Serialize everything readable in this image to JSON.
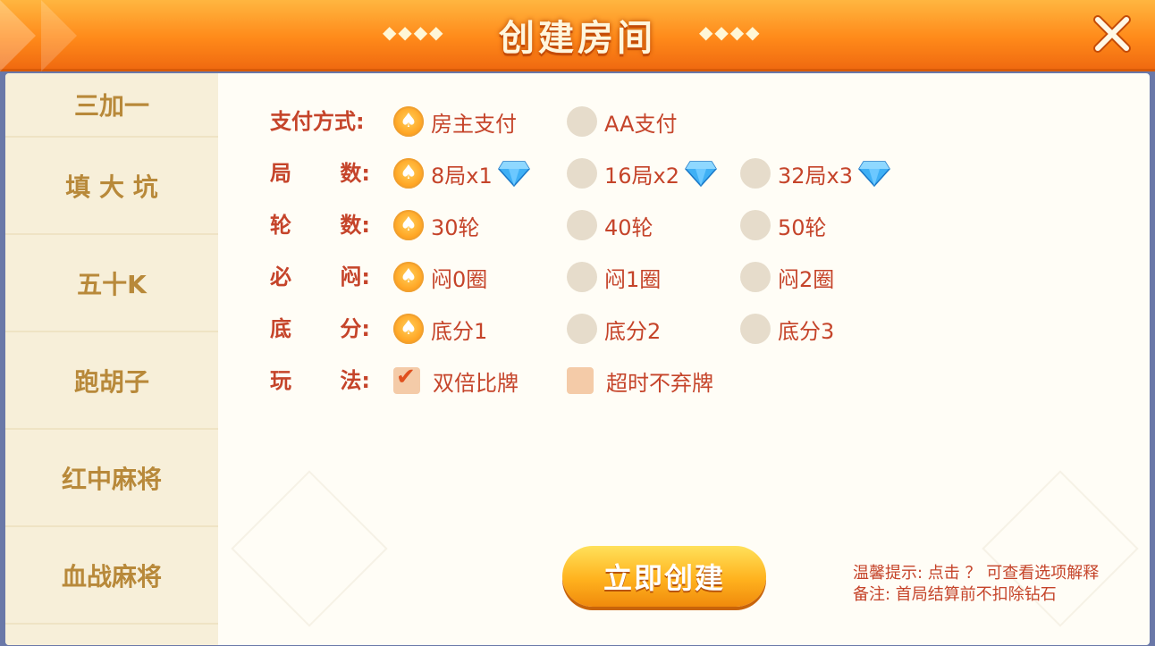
{
  "header": {
    "title": "创建房间",
    "deco_left": "◆◆◆◆",
    "deco_right": "◆◆◆◆",
    "close_icon": "close-icon"
  },
  "sidebar": {
    "items": [
      {
        "label": "三加一"
      },
      {
        "label": "填 大 坑"
      },
      {
        "label": "五十K"
      },
      {
        "label": "跑胡子"
      },
      {
        "label": "红中麻将"
      },
      {
        "label": "血战麻将"
      }
    ]
  },
  "rows": {
    "payment": {
      "label_a": "支付方式:",
      "options": [
        "房主支付",
        "AA支付"
      ],
      "selected": 0
    },
    "rounds": {
      "label_a": "局",
      "label_b": "数:",
      "options": [
        "8局x1",
        "16局x2",
        "32局x3"
      ],
      "selected": 0,
      "icon": "diamond-icon"
    },
    "turns": {
      "label_a": "轮",
      "label_b": "数:",
      "options": [
        "30轮",
        "40轮",
        "50轮"
      ],
      "selected": 0
    },
    "blind": {
      "label_a": "必",
      "label_b": "闷:",
      "options": [
        "闷0圈",
        "闷1圈",
        "闷2圈"
      ],
      "selected": 0
    },
    "base": {
      "label_a": "底",
      "label_b": "分:",
      "options": [
        "底分1",
        "底分2",
        "底分3"
      ],
      "selected": 0
    },
    "rules": {
      "label_a": "玩",
      "label_b": "法:",
      "options": [
        "双倍比牌",
        "超时不弃牌"
      ],
      "checked": [
        true,
        false
      ]
    }
  },
  "create_button": "立即创建",
  "tips": {
    "line1": "温馨提示: 点击 ？ 可查看选项解释",
    "line2": "备注: 首局结算前不扣除钻石"
  },
  "colors": {
    "accent": "#ff9f1c",
    "label": "#c5442a",
    "sidebar_text": "#b8893a"
  }
}
